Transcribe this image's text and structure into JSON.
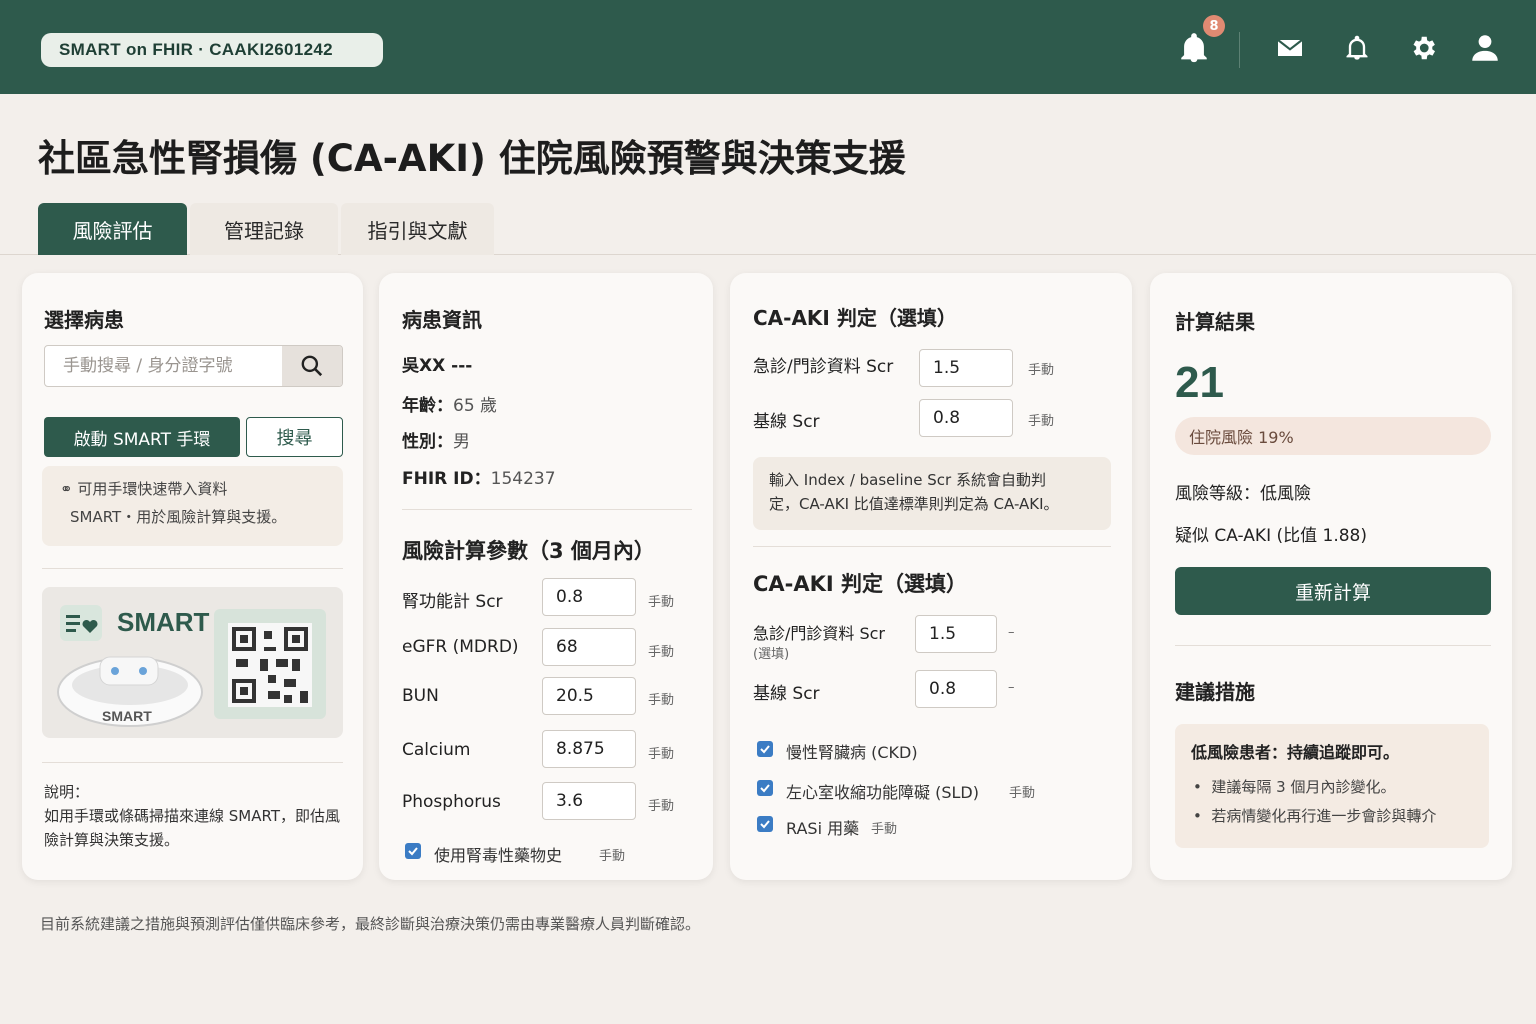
{
  "header": {
    "app_label": "SMART on FHIR · CAAKI2601242",
    "notification_count": "8",
    "icons": [
      "bell-alert-icon",
      "mail-icon",
      "bell-icon",
      "gear-icon",
      "user-icon"
    ]
  },
  "page_title": "社區急性腎損傷 (CA-AKI) 住院風險預警與決策支援",
  "tabs": [
    {
      "label": "風險評估",
      "active": true
    },
    {
      "label": "管理記錄",
      "active": false
    },
    {
      "label": "指引與文獻",
      "active": false
    }
  ],
  "patient_select": {
    "title": "選擇病患",
    "search_placeholder": "手動搜尋 / 身分證字號",
    "smart_button": "啟動 SMART 手環",
    "search_button": "搜尋",
    "info_line1": "⚭ 可用手環快速帶入資料",
    "info_line2": "SMART・用於風險計算與支援。",
    "smart_brand": "SMART",
    "band_label": "SMART",
    "note_title": "說明：",
    "note_body": "如用手環或條碼掃描來連線 SMART，即估風險計算與決策支援。"
  },
  "patient_info": {
    "title": "病患資訊",
    "name": "吳XX ---",
    "age_label": "年齡：",
    "age_value": "65 歲",
    "sex_label": "性別：",
    "sex_value": "男",
    "fhir_label": "FHIR ID：",
    "fhir_value": "154237",
    "params_title": "風險計算參數（3 個月內）",
    "params": [
      {
        "label": "腎功能計 Scr",
        "value": "0.8",
        "tag": "手動"
      },
      {
        "label": "eGFR (MDRD)",
        "value": "68",
        "tag": "手動"
      },
      {
        "label": "BUN",
        "value": "20.5",
        "tag": "手動"
      },
      {
        "label": "Calcium",
        "value": "8.875",
        "tag": "手動"
      },
      {
        "label": "Phosphorus",
        "value": "3.6",
        "tag": "手動"
      }
    ],
    "checkbox_label": "使用腎毒性藥物史",
    "checkbox_tag": "手動"
  },
  "caaki_judgement": {
    "title1": "CA-AKI 判定（選填）",
    "er_label": "急診/門診資料 Scr",
    "er_value": "1.5",
    "er_tag": "手動",
    "base_label": "基線 Scr",
    "base_value": "0.8",
    "base_tag": "手動",
    "hint_line1": "輸入 Index / baseline Scr  系統會自動判",
    "hint_line2": "定，CA-AKI 比值達標準則判定為 CA-AKI。",
    "title2": "CA-AKI 判定（選填）",
    "er2_label": "急診/門診資料 Scr",
    "er2_sub": "(選填)",
    "er2_value": "1.5",
    "er2_tag": "–",
    "base2_label": "基線 Scr",
    "base2_value": "0.8",
    "base2_tag": "–",
    "checks": [
      {
        "label": "慢性腎臟病 (CKD)",
        "tag": ""
      },
      {
        "label": "左心室收縮功能障礙 (SLD)",
        "tag": "手動"
      },
      {
        "label": "RASi 用藥",
        "tag": "手動"
      }
    ]
  },
  "result": {
    "title": "計算結果",
    "score": "21",
    "risk_pill": "住院風險 19%",
    "level": "風險等級：低風險",
    "caaki": "疑似 CA-AKI (比值 1.88)",
    "recalc_button": "重新計算",
    "rec_title": "建議措施",
    "rec_head": "低風險患者：持續追蹤即可。",
    "rec_items": [
      "建議每隔 3 個月內診變化。",
      "若病情變化再行進一步會診與轉介"
    ]
  },
  "footer": "目前系統建議之措施與預測評估僅供臨床參考，最終診斷與治療決策仍需由專業醫療人員判斷確認。"
}
